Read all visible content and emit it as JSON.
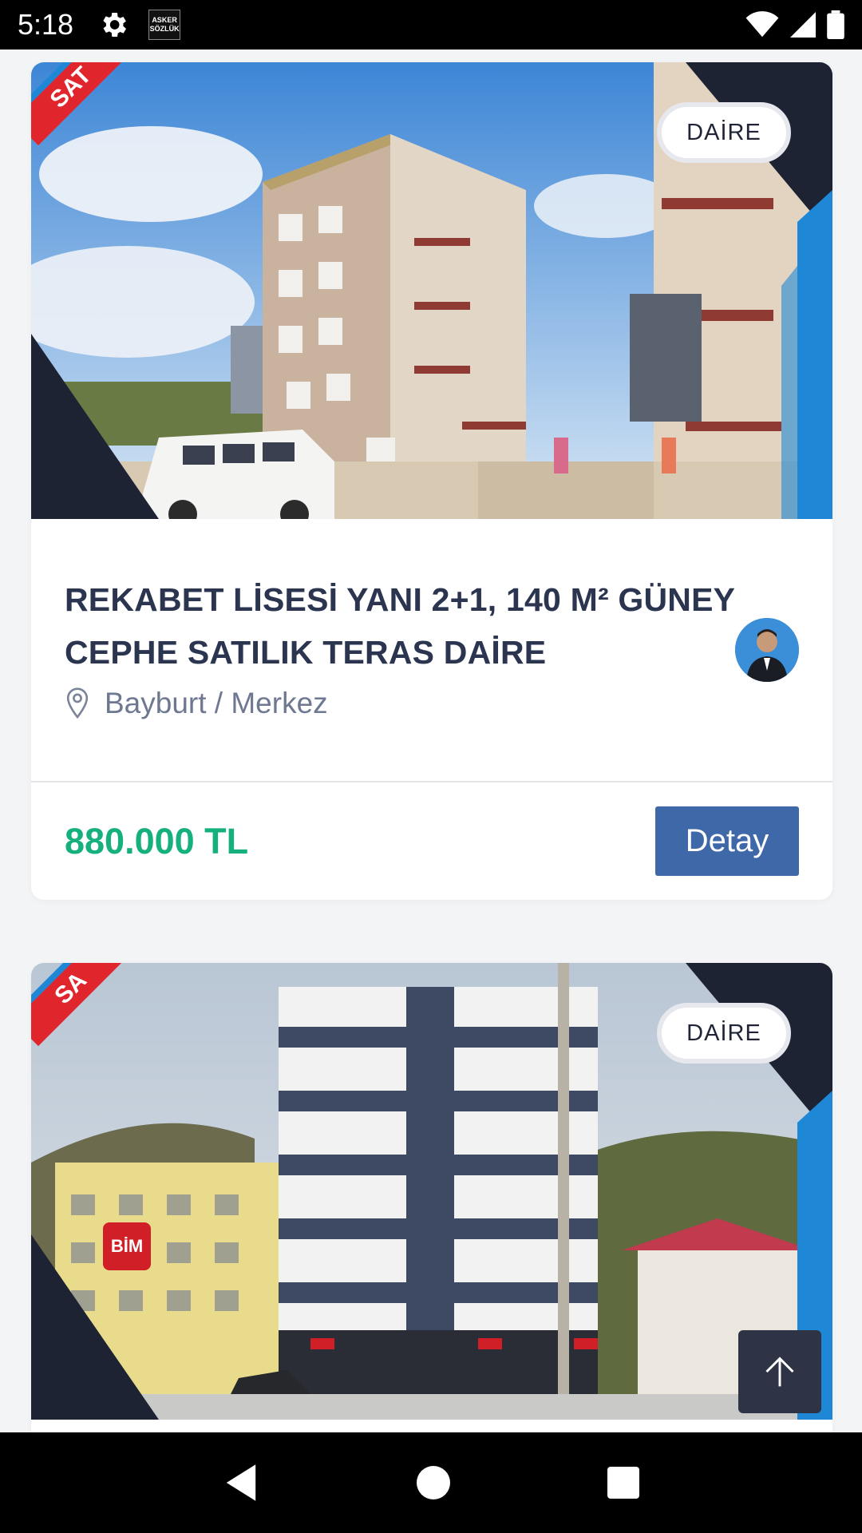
{
  "status_bar": {
    "time": "5:18",
    "app_badge_line1": "ASKER",
    "app_badge_line2": "SÖZLÜK",
    "icons": [
      "gear-icon",
      "wifi-icon",
      "signal-icon",
      "battery-icon"
    ]
  },
  "listings": [
    {
      "ribbon": "SAT",
      "category": "DAİRE",
      "title": "REKABET LİSESİ YANI 2+1, 140 M² GÜNEY CEPHE SATILIK TERAS DAİRE",
      "location": "Bayburt / Merkez",
      "price": "880.000 TL",
      "detail_label": "Detay"
    },
    {
      "ribbon": "SA",
      "category": "DAİRE",
      "store_sign": "BİM"
    }
  ],
  "colors": {
    "price": "#16b07f",
    "button": "#3e68a8",
    "title": "#2b3550",
    "ribbon": "#e0262c",
    "frame_dark": "#1e2333",
    "frame_blue": "#1f88d6"
  }
}
